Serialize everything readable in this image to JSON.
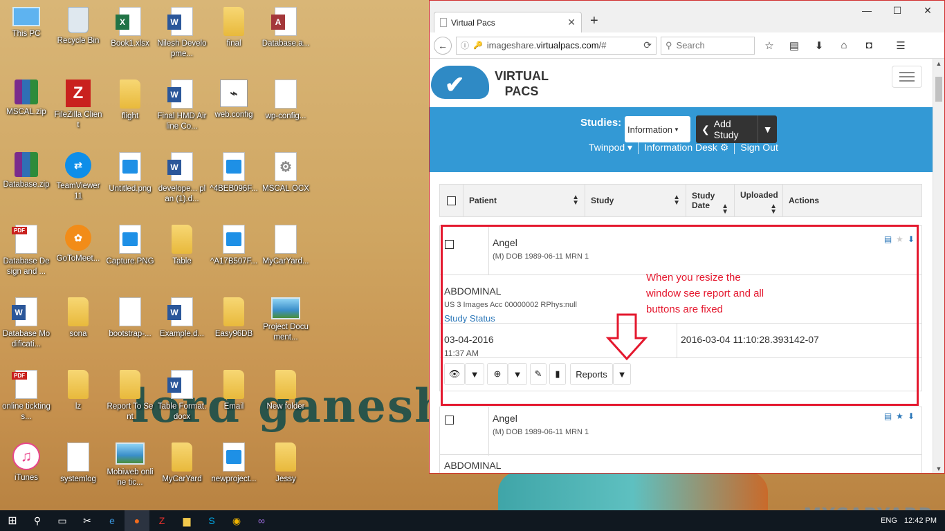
{
  "desktop": {
    "icons": [
      {
        "label": "This PC",
        "icon": "computer-icon"
      },
      {
        "label": "Recycle Bin",
        "icon": "recycle-bin-icon"
      },
      {
        "label": "Book1.xlsx",
        "icon": "excel-icon"
      },
      {
        "label": "Nilesh Developme...",
        "icon": "word-icon"
      },
      {
        "label": "final",
        "icon": "folder-icon"
      },
      {
        "label": "Database.a...",
        "icon": "access-icon"
      },
      {
        "label": "MSCAL.zip",
        "icon": "winrar-icon"
      },
      {
        "label": "FileZilla Client",
        "icon": "filezilla-icon"
      },
      {
        "label": "flight",
        "icon": "folder-icon"
      },
      {
        "label": "Final HMD Airline Co...",
        "icon": "word-icon"
      },
      {
        "label": "web.config",
        "icon": "config-icon"
      },
      {
        "label": "wp-config...",
        "icon": "file-icon"
      },
      {
        "label": "Database.zip",
        "icon": "winrar-icon"
      },
      {
        "label": "TeamViewer 11",
        "icon": "teamviewer-icon"
      },
      {
        "label": "Untitled.png",
        "icon": "image-icon"
      },
      {
        "label": "develope... plan (1).d...",
        "icon": "word-icon"
      },
      {
        "label": "^4BEB096F...",
        "icon": "image-icon"
      },
      {
        "label": "MSCAL.OCX",
        "icon": "gear-file-icon"
      },
      {
        "label": "Database Design and ...",
        "icon": "pdf-icon"
      },
      {
        "label": "GoToMeet...",
        "icon": "gotomeeting-icon"
      },
      {
        "label": "Capture.PNG",
        "icon": "image-icon"
      },
      {
        "label": "Table",
        "icon": "folder-icon"
      },
      {
        "label": "^A17B507F...",
        "icon": "image-icon"
      },
      {
        "label": "MyCarYard...",
        "icon": "text-file-icon"
      },
      {
        "label": "Database Modificati...",
        "icon": "word-icon"
      },
      {
        "label": "sona",
        "icon": "folder-icon"
      },
      {
        "label": "bootstrap-...",
        "icon": "file-icon"
      },
      {
        "label": "Example.d...",
        "icon": "word-icon"
      },
      {
        "label": "Easy96DB",
        "icon": "folder-icon"
      },
      {
        "label": "Project Document...",
        "icon": "landscape-image-icon"
      },
      {
        "label": "online tickting s...",
        "icon": "pdf-icon"
      },
      {
        "label": "lz",
        "icon": "folder-icon"
      },
      {
        "label": "Report To Sent",
        "icon": "folder-icon"
      },
      {
        "label": "Table Format.docx",
        "icon": "word-icon"
      },
      {
        "label": "Email",
        "icon": "folder-icon"
      },
      {
        "label": "New folder",
        "icon": "folder-icon"
      },
      {
        "label": "iTunes",
        "icon": "itunes-icon"
      },
      {
        "label": "systemlog",
        "icon": "file-icon"
      },
      {
        "label": "Mobiweb online tic...",
        "icon": "landscape-image-icon"
      },
      {
        "label": "MyCarYard",
        "icon": "folder-icon"
      },
      {
        "label": "newproject...",
        "icon": "image-icon"
      },
      {
        "label": "Jessy",
        "icon": "folder-icon"
      }
    ],
    "wallpaper_text": "lord ganesha",
    "watermark": "MYCARYARD"
  },
  "taskbar": {
    "language": "ENG",
    "time": "12:42 PM",
    "apps": [
      "start-icon",
      "search-icon",
      "task-view-icon",
      "tool-icon",
      "edge-icon",
      "firefox-icon",
      "filezilla-icon",
      "explorer-icon",
      "skype-icon",
      "chrome-icon",
      "visual-studio-icon"
    ]
  },
  "browser": {
    "tab_title": "Virtual Pacs",
    "url_prefix": "imageshare.",
    "url_host": "virtualpacs.com",
    "url_suffix": "/#",
    "search_placeholder": "Search"
  },
  "app": {
    "logo_line1": "VIRTUAL",
    "logo_line2": "PACS",
    "studies_label": "Studies:",
    "studies_select": "Information",
    "add_study": "Add Study",
    "nav_twinpod": "Twinpod",
    "nav_info_desk": "Information Desk",
    "nav_sign_out": "Sign Out",
    "columns": [
      "Patient",
      "Study",
      "Study Date",
      "Uploaded",
      "Actions"
    ],
    "column_study_date_l1": "Study",
    "column_study_date_l2": "Date",
    "row1": {
      "name": "Angel",
      "demo": "(M) DOB 1989-06-11 MRN 1",
      "study": "ABDOMINAL",
      "study_meta": "US 3 Images Acc 00000002 RPhys:null",
      "status_link": "Study Status",
      "date": "03-04-2016",
      "time": "11:37 AM",
      "uploaded": "2016-03-04 11:10:28.393142-07",
      "reports_label": "Reports"
    },
    "row2": {
      "name": "Angel",
      "demo": "(M) DOB 1989-06-11 MRN 1",
      "study": "ABDOMINAL"
    },
    "annotation": "When you resize the window see report and all buttons are fixed"
  },
  "colors": {
    "brand_blue": "#3399d5",
    "annotation_red": "#e4182e",
    "dark_button": "#333333"
  }
}
